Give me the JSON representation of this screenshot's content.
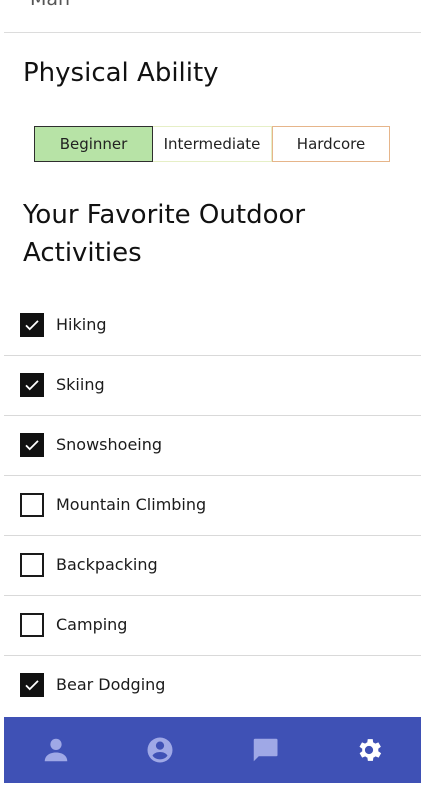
{
  "top": {
    "clipped_text": "Man"
  },
  "ability": {
    "title": "Physical Ability",
    "options": [
      "Beginner",
      "Intermediate",
      "Hardcore"
    ],
    "selected": "Beginner"
  },
  "activities": {
    "title": "Your Favorite Outdoor Activities",
    "items": [
      {
        "label": "Hiking",
        "checked": true
      },
      {
        "label": "Skiing",
        "checked": true
      },
      {
        "label": "Snowshoeing",
        "checked": true
      },
      {
        "label": "Mountain Climbing",
        "checked": false
      },
      {
        "label": "Backpacking",
        "checked": false
      },
      {
        "label": "Camping",
        "checked": false
      },
      {
        "label": "Bear Dodging",
        "checked": true
      }
    ]
  },
  "nav": {
    "items": [
      {
        "icon": "person-icon"
      },
      {
        "icon": "account-circle-icon"
      },
      {
        "icon": "chat-icon"
      },
      {
        "icon": "gear-icon",
        "active": true
      }
    ]
  },
  "colors": {
    "nav_bg": "#3f51b5",
    "selected_bg": "#b7e3a6"
  }
}
